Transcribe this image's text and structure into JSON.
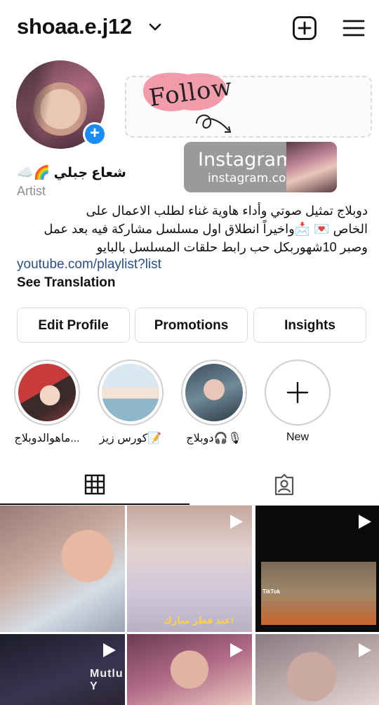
{
  "header": {
    "username": "shoaa.e.j12",
    "icons": [
      "chevron-down-icon",
      "add-post-icon",
      "menu-icon"
    ]
  },
  "profile": {
    "name": "شعاع جبلي 🌈☁️",
    "category": "Artist",
    "bio_lines": [
      "دوبلاج تمثيل صوتي وأداء هاوية غناء لطلب الاعمال على",
      "الخاص 💌 📩واخيراً انطلاق اول مسلسل مشاركة فيه بعد عمل",
      "وصبر 10شهوربكل حب رابط حلقات المسلسل بالبايو"
    ],
    "link": "youtube.com/playlist?list",
    "see_translation": "See Translation"
  },
  "sticker": {
    "follow_text": "Follow",
    "instagram_title": "Instagram",
    "instagram_sub": "instagram.com"
  },
  "actions": {
    "edit_profile": "Edit Profile",
    "promotions": "Promotions",
    "insights": "Insights"
  },
  "highlights": [
    {
      "label": "ماهوالدوبلاج..."
    },
    {
      "label": "كورس زيز📝"
    },
    {
      "label": "دوبلاج🎧🎙"
    },
    {
      "label": "New"
    }
  ],
  "tabs": {
    "active": "grid",
    "items": [
      "grid-icon",
      "tagged-icon"
    ]
  },
  "posts": [
    {
      "type": "photo"
    },
    {
      "type": "video",
      "caption": "عيد فطر مبارك!"
    },
    {
      "type": "video",
      "watermark": "TikTok"
    },
    {
      "type": "video",
      "caption": "Mutlu Y"
    },
    {
      "type": "video"
    },
    {
      "type": "video"
    }
  ],
  "colors": {
    "accent_blue": "#1d8cf4",
    "link_blue": "#2a4e85",
    "muted_text": "#8e8e8e",
    "border": "#dbdbdb"
  }
}
